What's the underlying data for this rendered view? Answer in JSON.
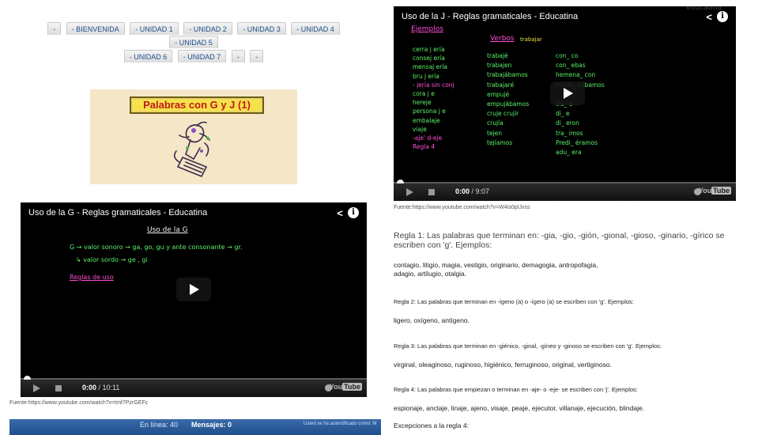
{
  "tabs": {
    "row1": [
      "-",
      "- BIENVENIDA",
      "- UNIDAD 1",
      "- UNIDAD 2",
      "- UNIDAD 3",
      "- UNIDAD 4",
      "- UNIDAD 5"
    ],
    "row2": [
      "- UNIDAD 6",
      "- UNIDAD 7",
      "-",
      "-"
    ]
  },
  "banner": {
    "title": "Palabras con G y J (1)"
  },
  "video_g": {
    "title": "Uso de la G - Reglas gramaticales - Educatina",
    "time_current": "0:00",
    "time_total": "/ 10:11",
    "chalk": {
      "heading": "Uso de la G",
      "line1": "G → valor sonoro → ga, go, gu y ante consonante → gr.",
      "line2": "↳ valor sordo → ge , gi",
      "line3": "Reglas de uso"
    },
    "source": "Fuente:https://www.youtube.com/watch?v=tmf7PzrGEFc"
  },
  "video_j": {
    "title": "Uso de la J - Reglas gramaticales - Educatina",
    "time_current": "0:00",
    "time_total": "/ 9:07",
    "chalk": {
      "heading": "Ejemplos",
      "verbos": "Verbos",
      "trabajar": "trabajar",
      "col1": [
        "cerra j ería",
        "consej ería",
        "mensaj ería",
        "bru j ería",
        "- jería sin conj",
        "cora j e",
        "hereje",
        "persona j e",
        "embalaje",
        "viaje",
        "-aje' d-eje",
        "Regla 4"
      ],
      "col2": [
        "trabajé",
        "trabajen",
        "trabajábamos",
        "trabajaré",
        "empujé",
        "empujábamos",
        "cruje crujir",
        "crujía",
        "tejen",
        "tejíamos"
      ],
      "col3": [
        "con_ co",
        "con_ ebas",
        "hemena_ con",
        "mena_ eábamos",
        "",
        "tra_ e",
        "di_ e",
        "di_ eron",
        "tra_ imos",
        "Predi_ éramos",
        "adu_ era"
      ]
    },
    "source": "Fuente:https://www.youtube.com/watch?v=W4is0pIJvss"
  },
  "statusbar": {
    "online": "En línea: 40",
    "messages": "Mensajes: 0",
    "auth": "Usted se ha autentificado como: M"
  },
  "watermark": "educatina",
  "rules": {
    "r1": "Regla 1: Las palabras que terminan en: -gia, -gio, -gión, -gional, -gioso, -ginario, -gírico se escriben con 'g'. Ejemplos:",
    "r1_ex_a": "contagio, litigio, magia, vestigio, originario, demagogia, antropofagia,",
    "r1_ex_b": "adagio, artilugio, otalgia.",
    "r2": "Regla 2: Las palabras que terminan en -ígeno (a) o -ígero (a) se escriben con 'g'. Ejemplos:",
    "r2_ex": "ligero, oxígeno, antígeno.",
    "r3": "Regla 3: Las palabras que terminan en -giénico, -ginal, -gíneo y -ginoso se escriben con 'g'. Ejemplos:",
    "r3_ex": "virginal, oleaginoso, ruginoso, higiénico, ferruginoso, original, vertiginoso.",
    "r4": "Regla 4: Las palabras que empiezan o terminan en -aje- o -eje- se escriben con 'j'. Ejemplos:",
    "r4_ex": "espionaje, anclaje, linaje, ajeno, visaje, peaje, ejecutor, villanaje, ejecución, blindaje.",
    "r4_exc": "Excepciones a la regla 4:"
  },
  "colors": {
    "chalk_green": "#5cf26a",
    "chalk_pink": "#ff4fd8",
    "chalk_white": "#f2f2f2",
    "chalk_yellow": "#f2e14a",
    "tab_text": "#1b4f8a"
  }
}
